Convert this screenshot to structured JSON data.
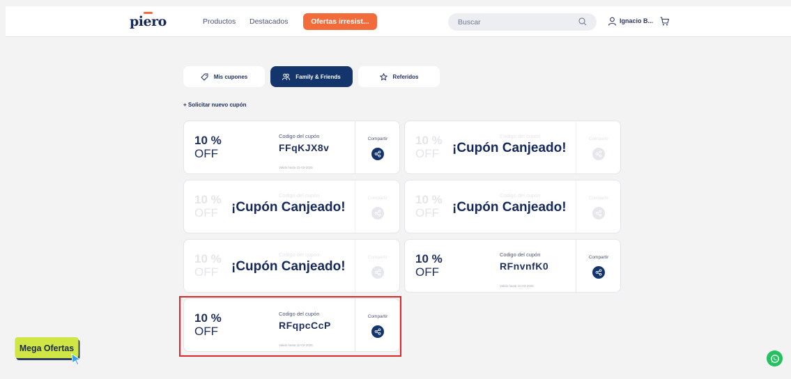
{
  "header": {
    "logo": "piero",
    "nav": {
      "products": "Productos",
      "featured": "Destacados",
      "offers": "Ofertas irresist..."
    },
    "search": {
      "placeholder": "Buscar"
    },
    "user": {
      "name": "Ignacio B..."
    }
  },
  "tabs": [
    {
      "label": "Mis cupones",
      "icon": "tag-icon",
      "active": false
    },
    {
      "label": "Family & Friends",
      "icon": "people-icon",
      "active": true
    },
    {
      "label": "Referidos",
      "icon": "star-icon",
      "active": false
    }
  ],
  "request_link": "+ Solicitar nuevo cupón",
  "coupons": [
    {
      "percent": "10 %",
      "off": "OFF",
      "code_label": "Codigo del cupón",
      "code": "FFqKJX8v",
      "valid": "Valido hasta 31-03-2025",
      "share_label": "Compartir",
      "redeemed": false
    },
    {
      "percent": "10 %",
      "off": "OFF",
      "code_label": "Codigo del cupón",
      "code": "",
      "valid": "",
      "share_label": "Compartir",
      "redeemed": true
    },
    {
      "percent": "10 %",
      "off": "OFF",
      "code_label": "Codigo del cupón",
      "code": "",
      "valid": "",
      "share_label": "Compartir",
      "redeemed": true
    },
    {
      "percent": "10 %",
      "off": "OFF",
      "code_label": "Codigo del cupón",
      "code": "",
      "valid": "",
      "share_label": "Compartir",
      "redeemed": true
    },
    {
      "percent": "10 %",
      "off": "OFF",
      "code_label": "Codigo del cupón",
      "code": "",
      "valid": "",
      "share_label": "Compartir",
      "redeemed": true
    },
    {
      "percent": "10 %",
      "off": "OFF",
      "code_label": "Codigo del cupón",
      "code": "RFnvnfK0",
      "valid": "Valido hasta 10-03-2025",
      "share_label": "Compartir",
      "redeemed": false
    },
    {
      "percent": "10 %",
      "off": "OFF",
      "code_label": "Codigo del cupón",
      "code": "RFqpcCcP",
      "valid": "Valido hasta 10-03-2025",
      "share_label": "Compartir",
      "redeemed": false
    }
  ],
  "redeemed_text": "¡Cupón Canjeado!",
  "mega_offers": "Mega Ofertas",
  "colors": {
    "primary": "#14346c",
    "accent": "#f26b3a",
    "highlight": "#e02626",
    "mega": "#cfe645",
    "whatsapp": "#25c05f"
  }
}
